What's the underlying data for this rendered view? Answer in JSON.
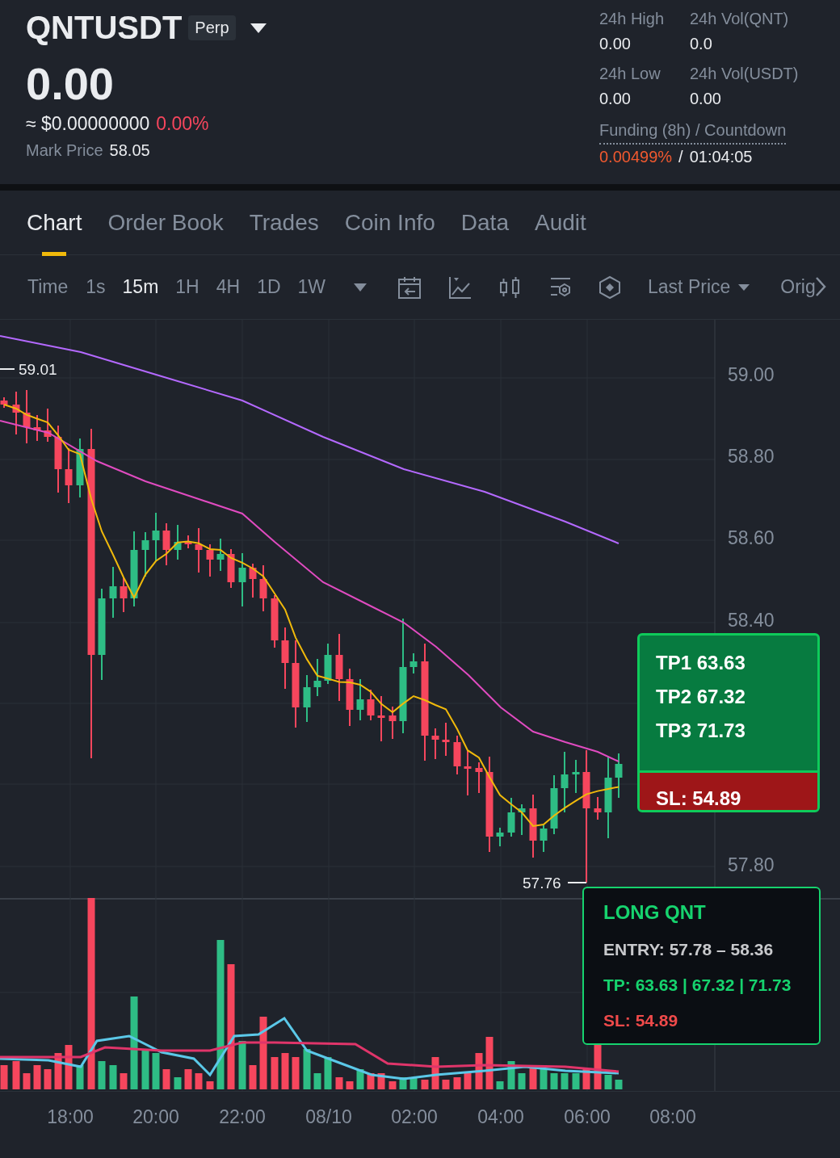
{
  "header": {
    "symbol": "QNTUSDT",
    "contract_badge": "Perp",
    "last_price": "0.00",
    "usd_price": "≈ $0.00000000",
    "change": "0.00%",
    "mark_price_label": "Mark Price",
    "mark_price": "58.05"
  },
  "stats": [
    {
      "label": "24h High",
      "value": "0.00"
    },
    {
      "label": "24h Vol(QNT)",
      "value": "0.0"
    },
    {
      "label": "24h Low",
      "value": "0.00"
    },
    {
      "label": "24h Vol(USDT)",
      "value": "0.00"
    }
  ],
  "funding": {
    "label": "Funding (8h) / Countdown",
    "rate": "0.00499%",
    "separator": "/",
    "countdown": "01:04:05"
  },
  "tabs": [
    {
      "label": "Chart",
      "selected": true
    },
    {
      "label": "Order Book",
      "selected": false
    },
    {
      "label": "Trades",
      "selected": false
    },
    {
      "label": "Coin Info",
      "selected": false
    },
    {
      "label": "Data",
      "selected": false
    },
    {
      "label": "Audit",
      "selected": false
    }
  ],
  "toolbar": {
    "time_label": "Time",
    "intervals": [
      {
        "label": "1s",
        "selected": false
      },
      {
        "label": "15m",
        "selected": true
      },
      {
        "label": "1H",
        "selected": false
      },
      {
        "label": "4H",
        "selected": false
      },
      {
        "label": "1D",
        "selected": false
      },
      {
        "label": "1W",
        "selected": false
      }
    ],
    "price_type": "Last Price",
    "cut_label": "Orig"
  },
  "chart": {
    "price_ticks": [
      "59.00",
      "58.80",
      "58.60",
      "58.40",
      "57.80"
    ],
    "high_marker": "59.01",
    "low_marker": "57.76",
    "time_ticks": [
      "18:00",
      "20:00",
      "22:00",
      "08/10",
      "02:00",
      "04:00",
      "06:00",
      "08:00"
    ]
  },
  "targets_card": {
    "take_profits": [
      "TP1 63.63",
      "TP2 67.32",
      "TP3 71.73"
    ],
    "stop_loss": "SL: 54.89"
  },
  "signal_card": {
    "title": "LONG QNT",
    "entry": "ENTRY: 57.78 – 58.36",
    "take_profit": "TP: 63.63 | 67.32 | 71.73",
    "stop_loss": "SL: 54.89"
  }
}
